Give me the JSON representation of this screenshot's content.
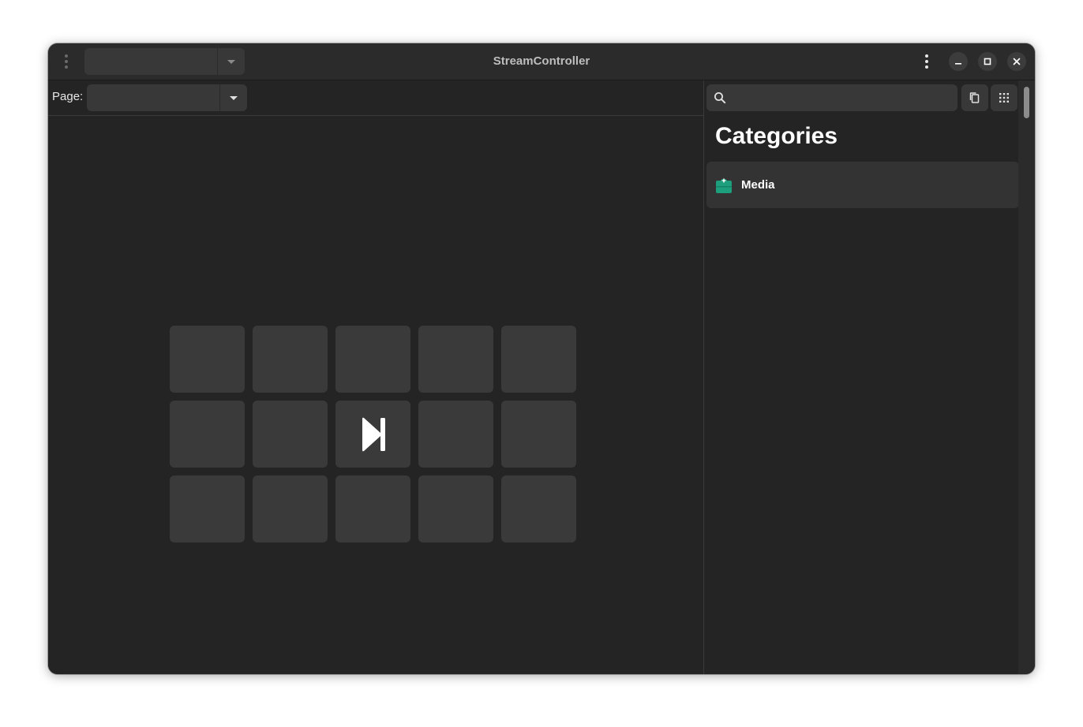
{
  "window": {
    "title": "StreamController"
  },
  "titlebar": {
    "deck_selector": {
      "value": ""
    },
    "menu_icon": "kebab-vertical-icon",
    "controls": [
      "minimize-icon",
      "maximize-icon",
      "close-icon"
    ]
  },
  "page_selector": {
    "label": "Page:",
    "value": ""
  },
  "deck": {
    "rows": 3,
    "columns": 5,
    "keys": [
      {
        "icon": ""
      },
      {
        "icon": ""
      },
      {
        "icon": ""
      },
      {
        "icon": ""
      },
      {
        "icon": ""
      },
      {
        "icon": ""
      },
      {
        "icon": ""
      },
      {
        "icon": "skip-forward-icon"
      },
      {
        "icon": ""
      },
      {
        "icon": ""
      },
      {
        "icon": ""
      },
      {
        "icon": ""
      },
      {
        "icon": ""
      },
      {
        "icon": ""
      },
      {
        "icon": ""
      }
    ]
  },
  "sidebar": {
    "search": {
      "value": "",
      "placeholder": ""
    },
    "heading": "Categories",
    "categories": [
      {
        "label": "Media",
        "icon": "media-category-icon",
        "icon_color": "#1d9e7c"
      }
    ]
  },
  "colors": {
    "window_bg": "#242424",
    "titlebar_bg": "#2b2b2b",
    "key_bg": "#3a3a3a",
    "accent": "#1d9e7c"
  }
}
